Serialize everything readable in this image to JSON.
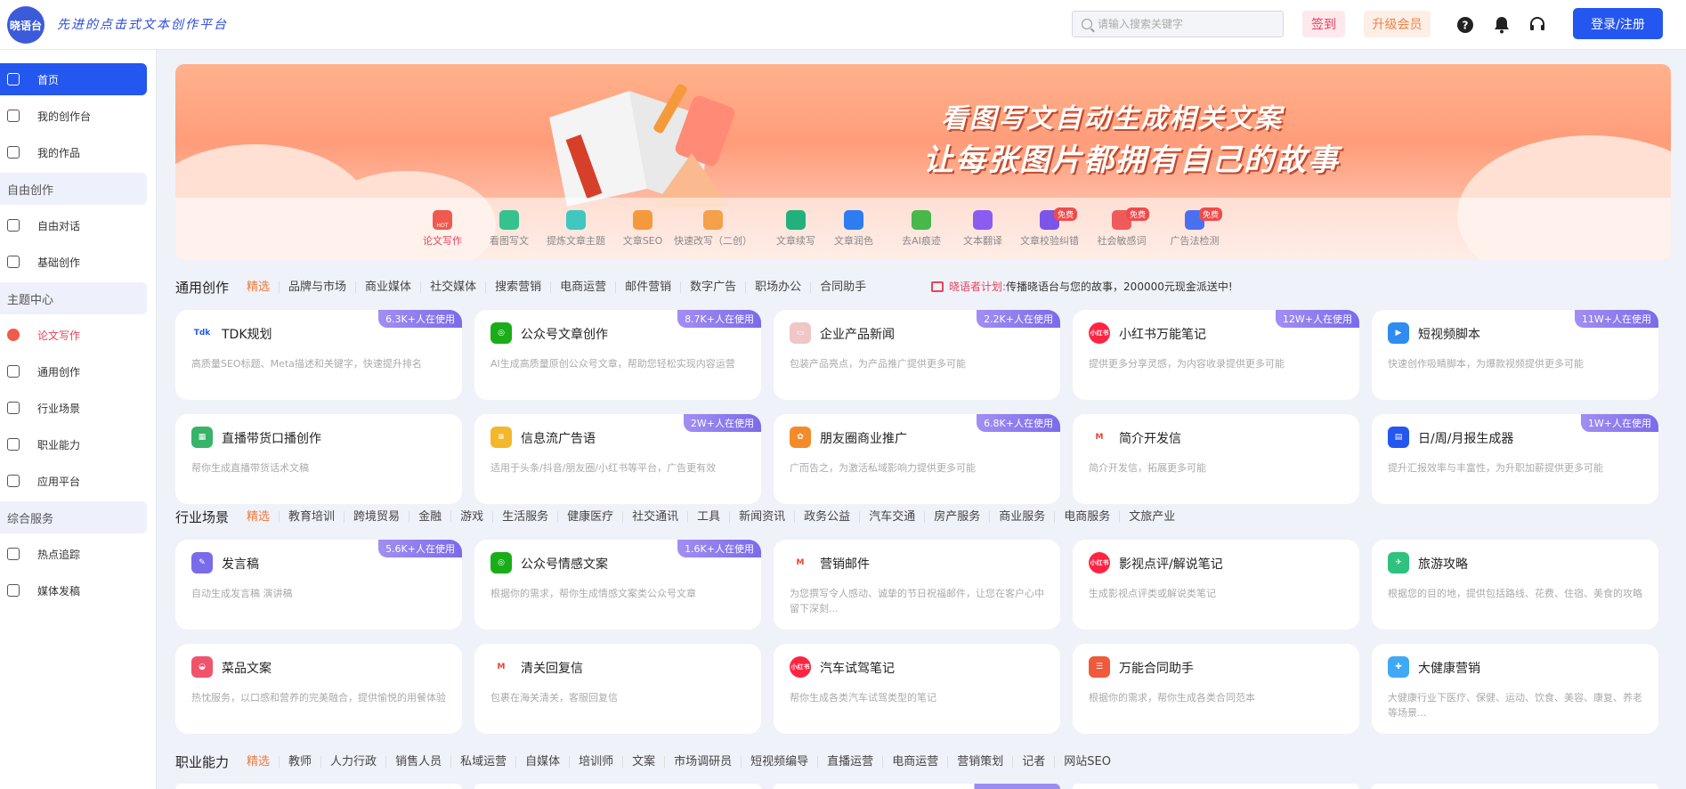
{
  "header": {
    "logo_text": "晓语台",
    "slogan": "先进的点击式文本创作平台",
    "search_placeholder": "请输入搜索关键字",
    "sign_label": "签到",
    "vip_label": "升级会员",
    "login_label": "登录/注册"
  },
  "sidebar": {
    "items": [
      {
        "label": "首页"
      },
      {
        "label": "我的创作台"
      },
      {
        "label": "我的作品"
      },
      {
        "label": "自由创作",
        "section": true
      },
      {
        "label": "自由对话"
      },
      {
        "label": "基础创作"
      },
      {
        "label": "主题中心",
        "section": true
      },
      {
        "label": "论文写作"
      },
      {
        "label": "通用创作"
      },
      {
        "label": "行业场景"
      },
      {
        "label": "职业能力"
      },
      {
        "label": "应用平台"
      },
      {
        "label": "综合服务",
        "section": true
      },
      {
        "label": "热点追踪"
      },
      {
        "label": "媒体发稿"
      }
    ]
  },
  "banner": {
    "line1": "看图写文自动生成相关文案",
    "line2": "让每张图片都拥有自己的故事",
    "tools": [
      {
        "label": "论文写作",
        "icon": "hot-icon",
        "color": "#f05a4e",
        "badge": "HOT"
      },
      {
        "label": "看图写文",
        "icon": "image-text-icon",
        "color": "#35c28f"
      },
      {
        "label": "提炼文章主题",
        "icon": "theme-icon",
        "color": "#3fc7c0"
      },
      {
        "label": "文章SEO",
        "icon": "seo-icon",
        "color": "#f59a3c"
      },
      {
        "label": "快速改写（二创）",
        "icon": "rewrite-icon",
        "color": "#f5a04b"
      },
      {
        "label": "文章续写",
        "icon": "continue-icon",
        "color": "#22b07d"
      },
      {
        "label": "文章润色",
        "icon": "polish-icon",
        "color": "#2d7cf0"
      },
      {
        "label": "去AI痕迹",
        "icon": "remove-ai-icon",
        "color": "#48b84a"
      },
      {
        "label": "文本翻译",
        "icon": "translate-icon",
        "color": "#8b5cf0"
      },
      {
        "label": "文章校验纠错",
        "icon": "check-icon",
        "color": "#7a55e8",
        "free": "免费"
      },
      {
        "label": "社会敏感词",
        "icon": "sensitive-icon",
        "color": "#ef5b5b",
        "free": "免费"
      },
      {
        "label": "广告法检测",
        "icon": "ad-law-icon",
        "color": "#4a70f0",
        "free": "免费"
      }
    ]
  },
  "general": {
    "title": "通用创作",
    "tabs": [
      "精选",
      "品牌与市场",
      "商业媒体",
      "社交媒体",
      "搜索营销",
      "电商运营",
      "邮件营销",
      "数字广告",
      "职场办公",
      "合同助手"
    ],
    "plan_label": "晓语者计划:",
    "plan_text": "传播晓语台与您的故事，200000元现金派送中!",
    "cards": [
      {
        "title": "TDK规划",
        "desc": "高质量SEO标题、Meta描述和关键字，快速提升排名",
        "tag": "6.3K+人在使用",
        "icon": "tdk-icon",
        "color": "#ffffff",
        "glyph": "Tdk"
      },
      {
        "title": "公众号文章创作",
        "desc": "AI生成高质量原创公众号文章，帮助您轻松实现内容运营",
        "tag": "8.7K+人在使用",
        "icon": "wechat-icon",
        "color": "#1aad19",
        "glyph": "◎"
      },
      {
        "title": "企业产品新闻",
        "desc": "包装产品亮点，为产品推广提供更多可能",
        "tag": "2.2K+人在使用",
        "icon": "news-icon",
        "color": "#f0c6c6",
        "glyph": "▭"
      },
      {
        "title": "小红书万能笔记",
        "desc": "提供更多分享灵感，为内容收录提供更多可能",
        "tag": "12W+人在使用",
        "icon": "xiaohongshu-icon",
        "color": "#ff2442",
        "glyph": "小红书"
      },
      {
        "title": "短视频脚本",
        "desc": "快速创作吸睛脚本，为爆款视频提供更多可能",
        "tag": "11W+人在使用",
        "icon": "video-icon",
        "color": "#2f8cf0",
        "glyph": "▶"
      },
      {
        "title": "直播带货口播创作",
        "desc": "帮你生成直播带货话术文稿",
        "tag": "",
        "icon": "clapper-icon",
        "color": "#38b36a",
        "glyph": "▦"
      },
      {
        "title": "信息流广告语",
        "desc": "适用于头条/抖音/朋友圈/小红书等平台，广告更有效",
        "tag": "2W+人在使用",
        "icon": "ad-icon",
        "color": "#f3b72b",
        "glyph": "≡"
      },
      {
        "title": "朋友圈商业推广",
        "desc": "广而告之，为激活私域影响力提供更多可能",
        "tag": "6.8K+人在使用",
        "icon": "moments-icon",
        "color": "#f38b2b",
        "glyph": "✿"
      },
      {
        "title": "简介开发信",
        "desc": "简介开发信，拓展更多可能",
        "tag": "",
        "icon": "gmail-icon",
        "color": "#ffffff",
        "glyph": "M"
      },
      {
        "title": "日/周/月报生成器",
        "desc": "提升汇报效率与丰富性，为升职加薪提供更多可能",
        "tag": "1W+人在使用",
        "icon": "report-icon",
        "color": "#2456f0",
        "glyph": "▤"
      }
    ]
  },
  "industry": {
    "title": "行业场景",
    "tabs": [
      "精选",
      "教育培训",
      "跨境贸易",
      "金融",
      "游戏",
      "生活服务",
      "健康医疗",
      "社交通讯",
      "工具",
      "新闻资讯",
      "政务公益",
      "汽车交通",
      "房产服务",
      "商业服务",
      "电商服务",
      "文旅产业"
    ],
    "cards": [
      {
        "title": "发言稿",
        "desc": "自动生成发言稿 演讲稿",
        "tag": "5.6K+人在使用",
        "icon": "speech-icon",
        "color": "#7a6bea",
        "glyph": "✎"
      },
      {
        "title": "公众号情感文案",
        "desc": "根据你的需求，帮你生成情感文案类公众号文章",
        "tag": "1.6K+人在使用",
        "icon": "wechat-icon",
        "color": "#1aad19",
        "glyph": "◎"
      },
      {
        "title": "营销邮件",
        "desc": "为您撰写令人感动、诚挚的节日祝福邮件，让您在客户心中留下深刻...",
        "tag": "",
        "icon": "gmail-icon",
        "color": "#ffffff",
        "glyph": "M"
      },
      {
        "title": "影视点评/解说笔记",
        "desc": "生成影视点评类或解说类笔记",
        "tag": "",
        "icon": "xiaohongshu-icon",
        "color": "#ff2442",
        "glyph": "小红书"
      },
      {
        "title": "旅游攻略",
        "desc": "根据您的目的地，提供包括路线、花费、住宿、美食的攻略",
        "tag": "",
        "icon": "travel-icon",
        "color": "#2ec27e",
        "glyph": "✈"
      },
      {
        "title": "菜品文案",
        "desc": "热忱服务，以口感和营养的完美融合，提供愉悦的用餐体验",
        "tag": "",
        "icon": "dish-icon",
        "color": "#f0546c",
        "glyph": "◒"
      },
      {
        "title": "清关回复信",
        "desc": "包裹在海关清关，客服回复信",
        "tag": "",
        "icon": "gmail-icon",
        "color": "#ffffff",
        "glyph": "M"
      },
      {
        "title": "汽车试驾笔记",
        "desc": "帮你生成各类汽车试驾类型的笔记",
        "tag": "",
        "icon": "xiaohongshu-icon",
        "color": "#ff2442",
        "glyph": "小红书"
      },
      {
        "title": "万能合同助手",
        "desc": "根据你的需求，帮你生成各类合同范本",
        "tag": "",
        "icon": "contract-icon",
        "color": "#f05a3c",
        "glyph": "☰"
      },
      {
        "title": "大健康营销",
        "desc": "大健康行业下医疗、保健、运动、饮食、美容、康复、养老等场景...",
        "tag": "",
        "icon": "health-icon",
        "color": "#3fa9f5",
        "glyph": "✚"
      }
    ]
  },
  "career": {
    "title": "职业能力",
    "tabs": [
      "精选",
      "教师",
      "人力行政",
      "销售人员",
      "私域运营",
      "自媒体",
      "培训师",
      "文案",
      "市场调研员",
      "短视频编导",
      "直播运营",
      "电商运营",
      "营销策划",
      "记者",
      "网站SEO"
    ]
  }
}
